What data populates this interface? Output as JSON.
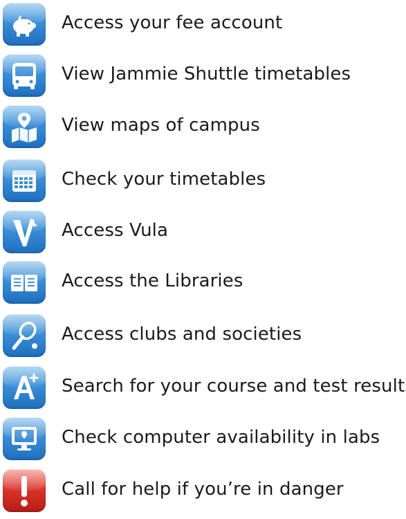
{
  "items": [
    {
      "label": "Access your fee account",
      "icon": "piggy-bank-icon",
      "accent": "#3b8ed6"
    },
    {
      "label": "View Jammie Shuttle timetables",
      "icon": "bus-icon",
      "accent": "#3b8ed6"
    },
    {
      "label": "View maps of campus",
      "icon": "map-icon",
      "accent": "#3b8ed6"
    },
    {
      "label": "Check your timetables",
      "icon": "calendar-icon",
      "accent": "#3b8ed6"
    },
    {
      "label": "Access Vula",
      "icon": "vula-icon",
      "accent": "#3b8ed6"
    },
    {
      "label": "Access the Libraries",
      "icon": "book-icon",
      "accent": "#3b8ed6"
    },
    {
      "label": "Access clubs and societies",
      "icon": "racquet-icon",
      "accent": "#3b8ed6"
    },
    {
      "label": "Search for your course and test results",
      "icon": "grade-a-plus-icon",
      "accent": "#3b8ed6"
    },
    {
      "label": "Check computer availability in labs",
      "icon": "computer-icon",
      "accent": "#3b8ed6"
    },
    {
      "label": "Call for help if you’re in danger",
      "icon": "alert-icon",
      "accent": "#d8322a"
    }
  ]
}
